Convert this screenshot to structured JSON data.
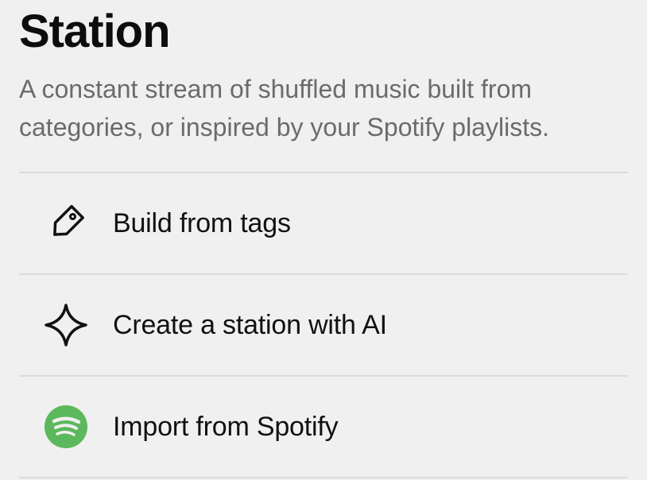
{
  "header": {
    "title": "Station",
    "description": "A constant stream of shuffled music built from categories, or inspired by your Spotify playlists."
  },
  "options": [
    {
      "label": "Build from tags",
      "icon": "tag-icon"
    },
    {
      "label": "Create a station with AI",
      "icon": "sparkle-icon"
    },
    {
      "label": "Import from Spotify",
      "icon": "spotify-icon"
    }
  ],
  "colors": {
    "background": "#f0f0f0",
    "description_text": "#6b6b6b",
    "divider": "#dcdcdc",
    "spotify_green": "#5cb85c"
  }
}
